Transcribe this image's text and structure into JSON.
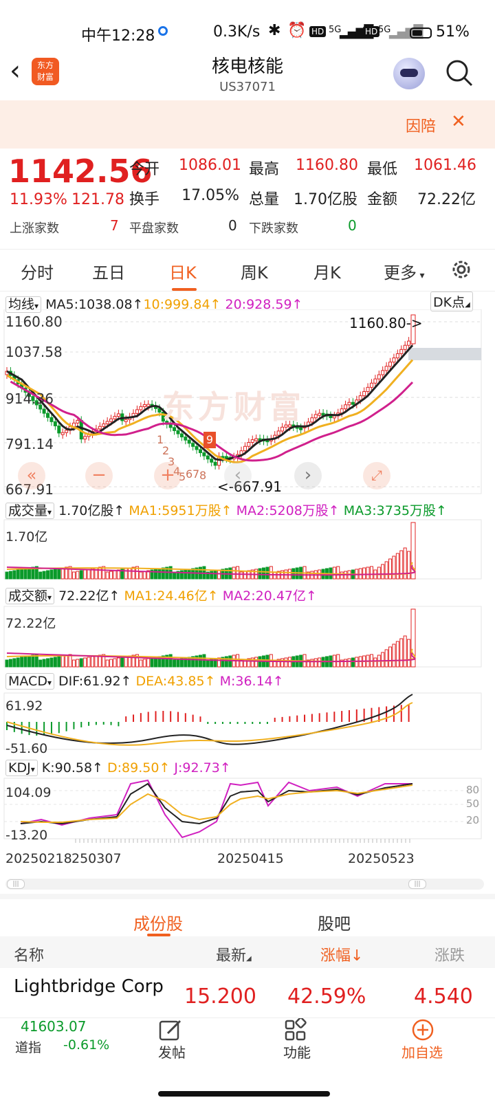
{
  "status": {
    "time": "中午12:28",
    "speed": "0.3K/s",
    "battery": "51%",
    "net1": "5G",
    "net2": "5G"
  },
  "header": {
    "title": "核电核能",
    "subtitle": "US37071",
    "logo_text": "东方\n财富"
  },
  "banner": {
    "text": "因陪"
  },
  "quote": {
    "price": "1142.56",
    "pct": "11.93%",
    "change": "121.78",
    "stats": [
      {
        "label": "今开",
        "value": "1086.01"
      },
      {
        "label": "最高",
        "value": "1160.80"
      },
      {
        "label": "最低",
        "value": "1061.46"
      },
      {
        "label": "换手",
        "value": "17.05%"
      },
      {
        "label": "总量",
        "value": "1.70亿股"
      },
      {
        "label": "金额",
        "value": "72.22亿"
      }
    ],
    "breadth": [
      {
        "label": "上涨家数",
        "value": "7"
      },
      {
        "label": "平盘家数",
        "value": "0"
      },
      {
        "label": "下跌家数",
        "value": "0"
      }
    ]
  },
  "tabs": [
    "分时",
    "五日",
    "日K",
    "周K",
    "月K",
    "更多"
  ],
  "active_tab": "日K",
  "kline": {
    "selector": "均线",
    "ma5": "MA5:1038.08↑",
    "ma10": "10:999.84↑",
    "ma20": "20:928.59↑",
    "dk": "DK点",
    "axis": [
      "1160.80",
      "1037.58",
      "914.36",
      "791.14",
      "667.91"
    ],
    "high_label": "1160.80->",
    "low_label": "<-667.91",
    "watermark": "东方财富",
    "markers": [
      "9",
      "1",
      "2",
      "3",
      "4",
      "5",
      "6",
      "7",
      "8"
    ]
  },
  "volume": {
    "selector": "成交量",
    "value": "1.70亿股↑",
    "ma1": "MA1:5951万股↑",
    "ma2": "MA2:5208万股↑",
    "ma3": "MA3:3735万股↑",
    "axis": "1.70亿"
  },
  "amount": {
    "selector": "成交额",
    "value": "72.22亿↑",
    "ma1": "MA1:24.46亿↑",
    "ma2": "MA2:20.47亿↑",
    "axis": "72.22亿"
  },
  "macd": {
    "selector": "MACD",
    "dif": "DIF:61.92↑",
    "dea": "DEA:43.85↑",
    "m": "M:36.14↑",
    "axis_top": "61.92",
    "axis_bot": "-51.60"
  },
  "kdj": {
    "selector": "KDJ",
    "k": "K:90.58↑",
    "d": "D:89.50↑",
    "j": "J:92.73↑",
    "axis_top": "104.09",
    "axis_bot": "-13.20",
    "levels": [
      "80",
      "50",
      "20"
    ]
  },
  "dates": [
    "20250218",
    "250307",
    "20250415",
    "20250523"
  ],
  "section_tabs": [
    "成份股",
    "股吧"
  ],
  "table": {
    "headers": [
      "名称",
      "最新",
      "涨幅↓",
      "涨跌"
    ],
    "row": {
      "name": "Lightbridge Corp",
      "last": "15.200",
      "pct": "42.59%",
      "chg": "4.540"
    }
  },
  "bottom": {
    "index_value": "41603.07",
    "index_name": "道指",
    "index_pct": "-0.61%",
    "post": "发帖",
    "func": "功能",
    "add": "加自选"
  },
  "colors": {
    "up": "#e02020",
    "down": "#0a9a2a",
    "accent": "#f06020"
  }
}
